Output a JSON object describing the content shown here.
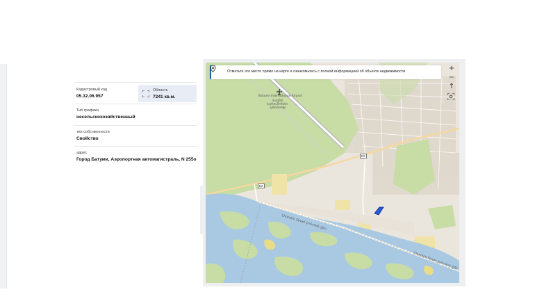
{
  "details": {
    "cadastral_label": "Кадастровый код",
    "cadastral_value": "05.32.06.957",
    "area_label": "Область",
    "area_value": "7241 кв.м.",
    "land_type_label": "Тип графика",
    "land_type_value": "несельскохозяйственный",
    "ownership_label": "тип собственности",
    "ownership_value": "Свойство",
    "address_label": "адрес",
    "address_value": "Город Батуми, Аэропортная автомагистраль, N 255о"
  },
  "map": {
    "banner_text": "Отметьте это место прямо на карте и ознакомьтесь с полной информацией об объекте недвижимости.",
    "controls": {
      "zoom_in": "+",
      "zoom_out": "−",
      "north": "↑"
    },
    "labels": {
      "airport_en": "Batumi International Airport",
      "airport_ka_1": "ბათუმის",
      "airport_ka_2": "საერთაშორისო",
      "airport_ka_3": "აეროპორტი",
      "road_1": "B2",
      "road_2": "B2",
      "street_1": "Chorokhi Street ჭოროხის ქუჩა",
      "street_2": "Chorokhi Street ჭოროხის ქუჩა"
    },
    "colors": {
      "parcel_fill": "#2b5bd7",
      "water": "#a9c9e3",
      "green": "#c6dca0",
      "urban": "#e7e1d6"
    }
  }
}
